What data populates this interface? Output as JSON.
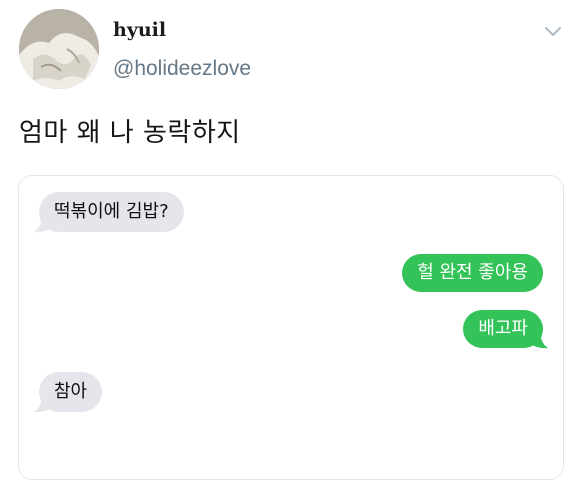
{
  "tweet": {
    "display_name": "hyuil",
    "handle": "@holideezlove",
    "text": "엄마 왜 나 농락하지",
    "menu_icon": "chevron-down-icon"
  },
  "conversation": {
    "messages": [
      {
        "direction": "received",
        "text": "떡볶이에 김밥?"
      },
      {
        "direction": "sent",
        "text": "헐 완전 좋아용"
      },
      {
        "direction": "sent",
        "text": "배고파"
      },
      {
        "direction": "received",
        "text": "참아"
      }
    ],
    "colors": {
      "sent_bubble": "#33c359",
      "received_bubble": "#e6e5eb"
    }
  }
}
